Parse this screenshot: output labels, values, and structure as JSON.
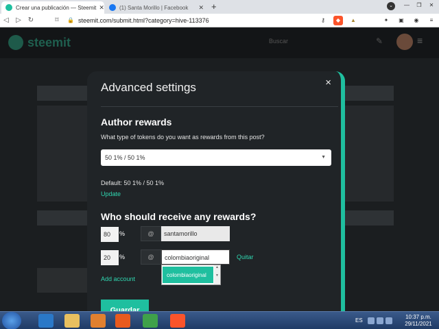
{
  "browser": {
    "tabs": [
      {
        "title": "Crear una publicación — Steemit",
        "favicon_color": "#1fbf9f"
      },
      {
        "title": "(1) Santa Morillo | Facebook",
        "favicon_color": "#1877f2"
      }
    ],
    "new_tab": "+",
    "url": "steemit.com/submit.html?category=hive-113376"
  },
  "site": {
    "logo": "steemit",
    "search_placeholder": "Buscar"
  },
  "modal": {
    "title": "Advanced settings",
    "close": "×",
    "author_rewards": {
      "heading": "Author rewards",
      "question": "What type of tokens do you want as rewards from this post?",
      "selected": "50 1% / 50 1%",
      "default_text": "Default: 50 1% / 50 1%",
      "update_label": "Update"
    },
    "beneficiaries": {
      "heading": "Who should receive any rewards?",
      "rows": [
        {
          "percent": "80",
          "percent_sign": "%",
          "at": "@",
          "account": "santamorillo"
        },
        {
          "percent": "20",
          "percent_sign": "%",
          "at": "@",
          "account": "colombiaoriginal",
          "remove_label": "Quitar"
        }
      ],
      "autocomplete_option": "colombiaoriginal",
      "add_account_label": "Add account"
    },
    "save_label": "Guardar"
  },
  "taskbar": {
    "lang": "ES",
    "time": "10:37 p.m.",
    "date": "29/11/2021"
  },
  "colors": {
    "accent": "#1fbf9f",
    "modal_bg": "#202427"
  }
}
